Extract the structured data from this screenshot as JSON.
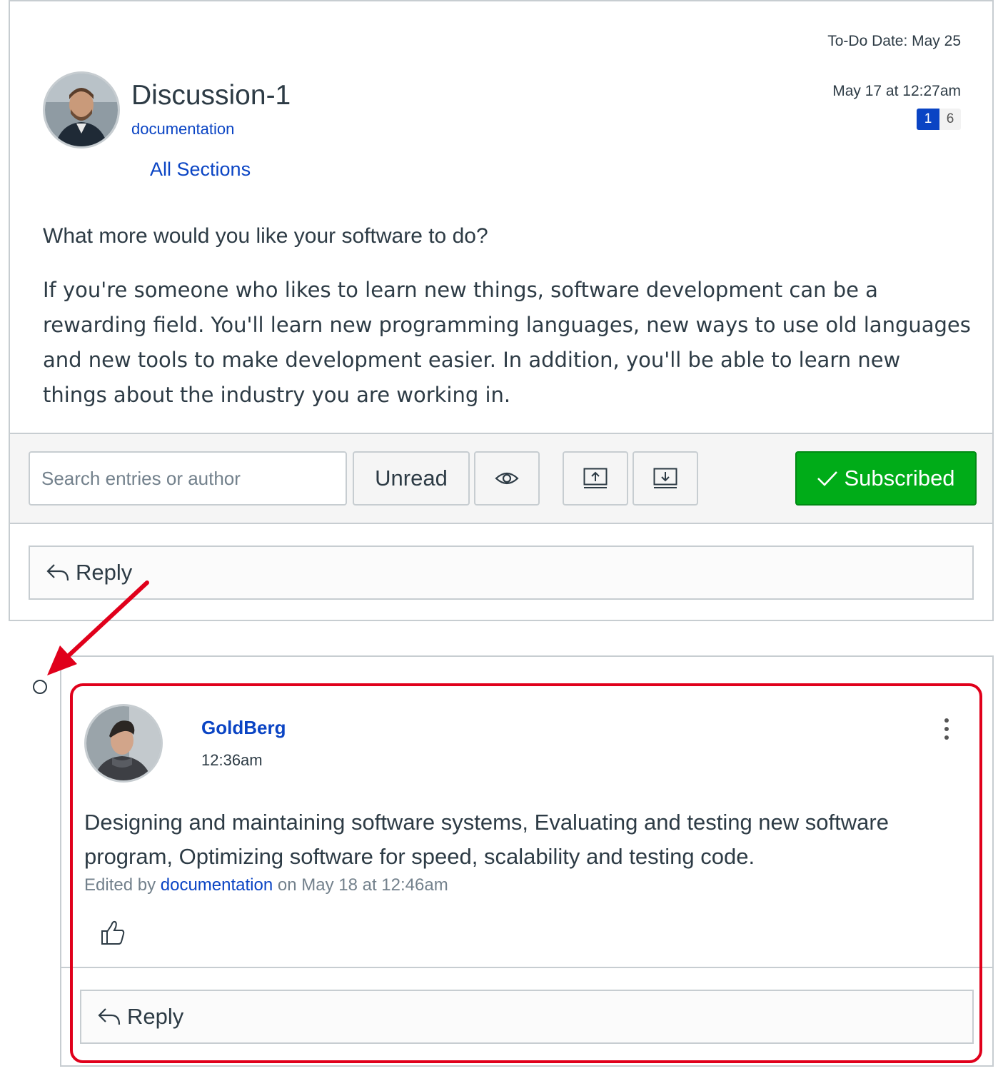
{
  "topic": {
    "todo_date": "To-Do Date: May 25",
    "posted": "May 17 at 12:27am",
    "unread_count": "1",
    "total_count": "6",
    "title": "Discussion-1",
    "author": "documentation",
    "sections": "All Sections",
    "question": "What more would you like your software to do?",
    "body": "If you're someone who likes to learn new things, software development can be a rewarding field. You'll learn new programming languages, new ways to use old languages and new tools to make development easier. In addition, you'll be able to learn new things about the industry you are working in."
  },
  "toolbar": {
    "search_placeholder": "Search entries or author",
    "unread_label": "Unread",
    "subscribed_label": "Subscribed",
    "icons": [
      "eye-icon",
      "collapse-icon",
      "expand-icon",
      "checkmark-icon"
    ]
  },
  "reply_label": "Reply",
  "entry": {
    "author": "GoldBerg",
    "time": "12:36am",
    "body": "Designing and maintaining software systems, Evaluating and testing new software program, Optimizing software for speed, scalability and testing code.",
    "edited_prefix": "Edited by",
    "edited_by": "documentation",
    "edited_suffix": "on May 18 at 12:46am",
    "reply_label": "Reply"
  },
  "colors": {
    "link": "#0a44c4",
    "subscribed": "#00ac18",
    "annotation": "#e0001b"
  }
}
